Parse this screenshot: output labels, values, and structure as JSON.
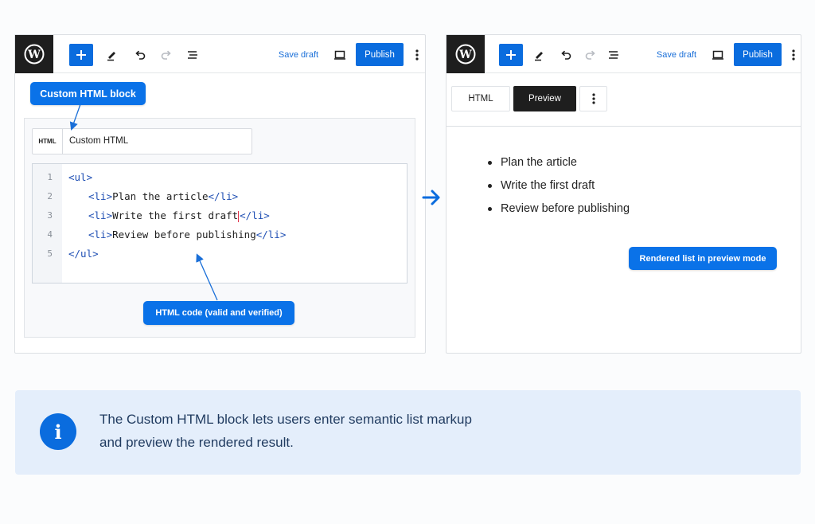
{
  "left_editor": {
    "toolbar": {
      "save_draft": "Save draft",
      "publish": "Publish"
    },
    "callout_block": "Custom HTML block",
    "block": {
      "type_badge": "HTML",
      "label": "Custom HTML"
    },
    "code": {
      "line_numbers": [
        "1",
        "2",
        "3",
        "4",
        "5"
      ],
      "lines": [
        {
          "open": "<ul>",
          "text": "",
          "close": ""
        },
        {
          "open": "<li>",
          "text": "Plan the article",
          "close": "</li>"
        },
        {
          "open": "<li>",
          "text": "Write the first draft",
          "close": "</li>"
        },
        {
          "open": "<li>",
          "text": "Review before publishing",
          "close": "</li>"
        },
        {
          "open": "</ul>",
          "text": "",
          "close": ""
        }
      ]
    },
    "callout_code": "HTML code (valid and verified)"
  },
  "right_editor": {
    "toolbar": {
      "save_draft": "Save draft",
      "publish": "Publish"
    },
    "tabs": {
      "html": "HTML",
      "preview": "Preview",
      "active": "Preview"
    },
    "preview_items": [
      "Plan the article",
      "Write the first draft",
      "Review before publishing"
    ],
    "callout_preview": "Rendered list in preview mode"
  },
  "info": {
    "icon": "info-icon",
    "line1": "The Custom HTML block lets users enter semantic list markup",
    "line2": "and preview the rendered result."
  },
  "colors": {
    "accent": "#0a6cde",
    "callout": "#0a72e8",
    "wp_logo_bg": "#1e1e1e",
    "banner_bg": "#e4eefb",
    "tag_color": "#1f4fb4"
  }
}
